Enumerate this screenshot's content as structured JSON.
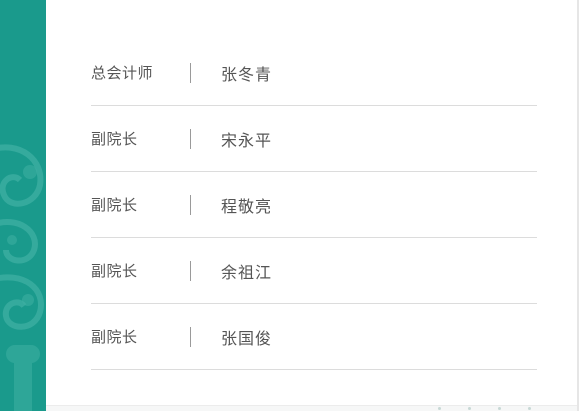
{
  "colors": {
    "band": "#1a9a8c",
    "band_pattern": "#3fb0a3",
    "divider": "#dcdcdc",
    "text": "#555555"
  },
  "leaders": [
    {
      "role": "总会计师",
      "name": "张冬青"
    },
    {
      "role": "副院长",
      "name": "宋永平"
    },
    {
      "role": "副院长",
      "name": "程敬亮"
    },
    {
      "role": "副院长",
      "name": "余祖江"
    },
    {
      "role": "副院长",
      "name": "张国俊"
    }
  ]
}
